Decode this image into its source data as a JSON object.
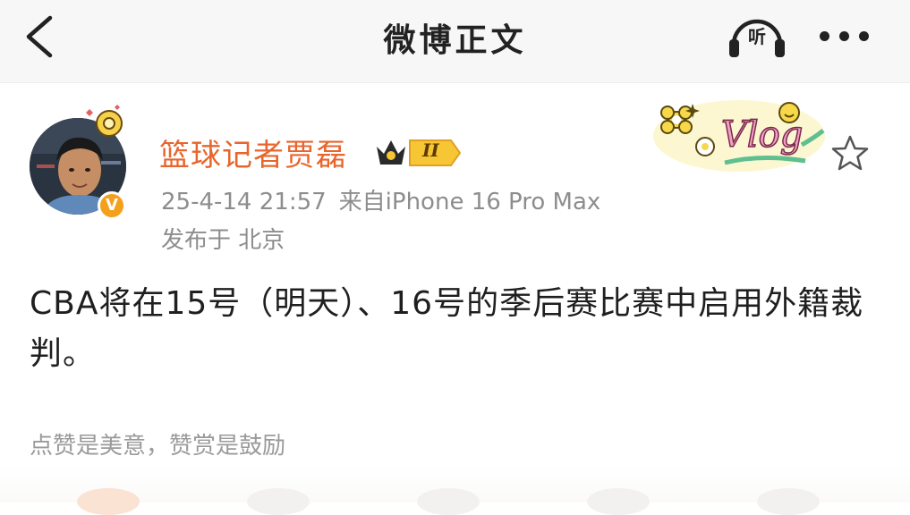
{
  "header": {
    "title": "微博正文",
    "listen_label": "听",
    "icons": {
      "back": "chevron-left-icon",
      "listen": "headphones-icon",
      "more": "more-dots-icon"
    }
  },
  "post": {
    "author": {
      "name": "篮球记者贾磊",
      "verified_icon": "verified-v-icon",
      "level_badge": "II",
      "name_color": "#e8652c"
    },
    "timestamp": "25-4-14 21:57",
    "source": "来自iPhone 16 Pro Max",
    "location": "发布于 北京",
    "content": "CBA将在15号（明天）、16号的季后赛比赛中启用外籍裁判。",
    "decoration_label": "Vlog",
    "favorite_icon": "star-outline-icon"
  },
  "footer": {
    "reward_text": "点赞是美意，赞赏是鼓励"
  },
  "colors": {
    "accent": "#e8652c",
    "meta": "#8d8d8d",
    "verified": "#f3a01c"
  }
}
